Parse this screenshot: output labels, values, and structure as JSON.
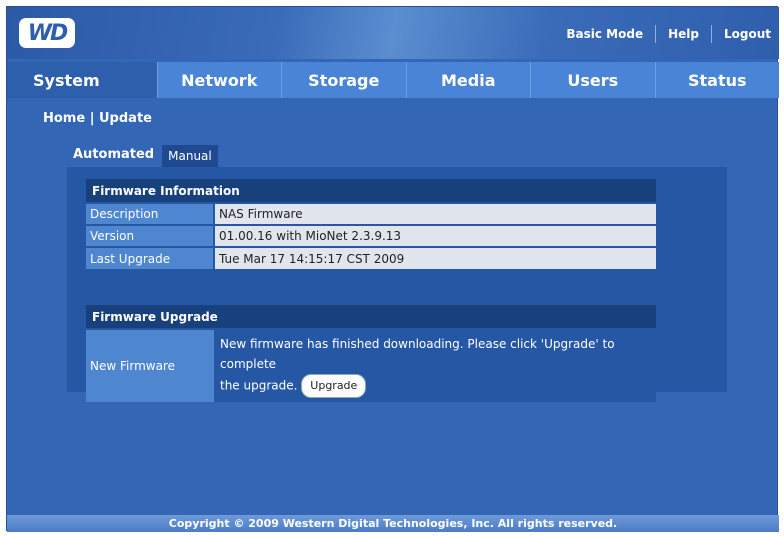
{
  "header": {
    "logo_text": "WD",
    "links": {
      "basic_mode": "Basic Mode",
      "help": "Help",
      "logout": "Logout"
    }
  },
  "nav": {
    "items": [
      {
        "label": "System",
        "active": true
      },
      {
        "label": "Network",
        "active": false
      },
      {
        "label": "Storage",
        "active": false
      },
      {
        "label": "Media",
        "active": false
      },
      {
        "label": "Users",
        "active": false
      },
      {
        "label": "Status",
        "active": false
      }
    ]
  },
  "breadcrumb": {
    "home": "Home",
    "separator": "|",
    "current": "Update"
  },
  "tabs": {
    "automated": "Automated",
    "manual": "Manual"
  },
  "firmware_info": {
    "title": "Firmware Information",
    "rows": [
      {
        "label": "Description",
        "value": "NAS Firmware"
      },
      {
        "label": "Version",
        "value": "01.00.16 with MioNet 2.3.9.13"
      },
      {
        "label": "Last Upgrade",
        "value": "Tue Mar 17 14:15:17 CST 2009"
      }
    ]
  },
  "firmware_upgrade": {
    "title": "Firmware Upgrade",
    "label": "New Firmware",
    "message_line1": "New firmware has finished downloading. Please click 'Upgrade' to complete",
    "message_line2": "the upgrade.",
    "button_label": "Upgrade"
  },
  "footer": {
    "copyright": "Copyright © 2009 Western Digital Technologies, Inc. All rights reserved."
  },
  "colors": {
    "background": "#3366b5",
    "nav": "#4a84d6",
    "section_header": "#17407d"
  }
}
